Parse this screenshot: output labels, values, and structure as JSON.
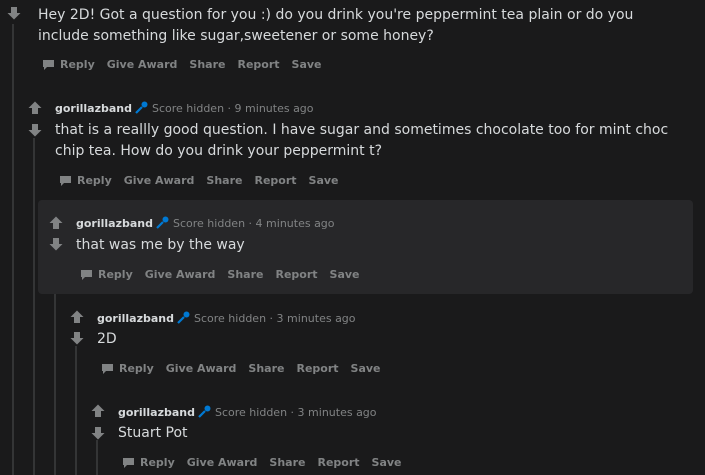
{
  "comments": [
    {
      "author": "",
      "score": "",
      "time": "",
      "body": "Hey 2D! Got a question for you :) do you drink you're peppermint tea plain or do you include something like sugar,sweetener or some honey?"
    },
    {
      "author": "gorillazband",
      "score": "Score hidden",
      "time": "9 minutes ago",
      "body": "that is a reallly good question. I have sugar and sometimes chocolate too for mint choc chip tea. How do you drink your peppermint t?"
    },
    {
      "author": "gorillazband",
      "score": "Score hidden",
      "time": "4 minutes ago",
      "body": "that was me by the way"
    },
    {
      "author": "gorillazband",
      "score": "Score hidden",
      "time": "3 minutes ago",
      "body": "2D"
    },
    {
      "author": "gorillazband",
      "score": "Score hidden",
      "time": "3 minutes ago",
      "body": "Stuart Pot"
    }
  ],
  "actions": {
    "reply": "Reply",
    "award": "Give Award",
    "share": "Share",
    "report": "Report",
    "save": "Save"
  },
  "separator": "·",
  "colors": {
    "background": "#1a1a1b",
    "text": "#d7dadc",
    "muted": "#818384",
    "flair": "#0079d3"
  },
  "icons": {
    "upvote": "arrow-up-icon",
    "downvote": "arrow-down-icon",
    "reply": "comment-bubble-icon",
    "flair": "microphone-flair-icon"
  }
}
